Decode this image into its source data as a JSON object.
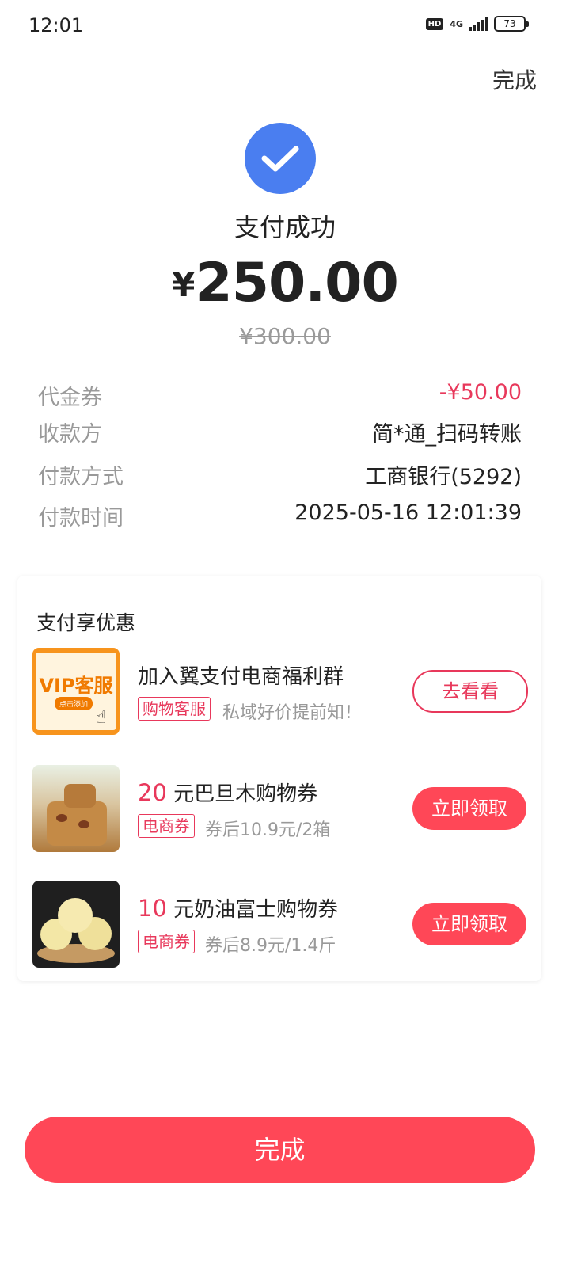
{
  "status_bar": {
    "time": "12:01",
    "hd": "HD",
    "network": "4G",
    "battery": "73"
  },
  "header": {
    "done_label": "完成"
  },
  "payment": {
    "status": "支付成功",
    "currency": "¥",
    "amount": "250.00",
    "original_amount": "¥300.00",
    "check_color": "#4a7ef0"
  },
  "details": [
    {
      "label": "代金券",
      "value": "-¥50.00"
    },
    {
      "label": "收款方",
      "value": "简*通_扫码转账"
    },
    {
      "label": "付款方式",
      "value": "工商银行(5292)"
    },
    {
      "label": "付款时间",
      "value": "2025-05-16 12:01:39"
    }
  ],
  "promo": {
    "title": "支付享优惠",
    "items": [
      {
        "title": "加入翼支付电商福利群",
        "tag": "购物客服",
        "subtitle": "私域好价提前知！",
        "button": "去看看",
        "thumb_text": "VIP客服",
        "thumb_sub": "点击添加"
      },
      {
        "highlight": "20",
        "title": "元巴旦木购物券",
        "tag": "电商券",
        "subtitle": "券后10.9元/2箱",
        "button": "立即领取"
      },
      {
        "highlight": "10",
        "title": "元奶油富士购物券",
        "tag": "电商券",
        "subtitle": "券后8.9元/1.4斤",
        "button": "立即领取"
      }
    ]
  },
  "footer": {
    "done_label": "完成"
  },
  "colors": {
    "accent": "#ff4757",
    "accent_text": "#e8385b",
    "success": "#4a7ef0"
  }
}
